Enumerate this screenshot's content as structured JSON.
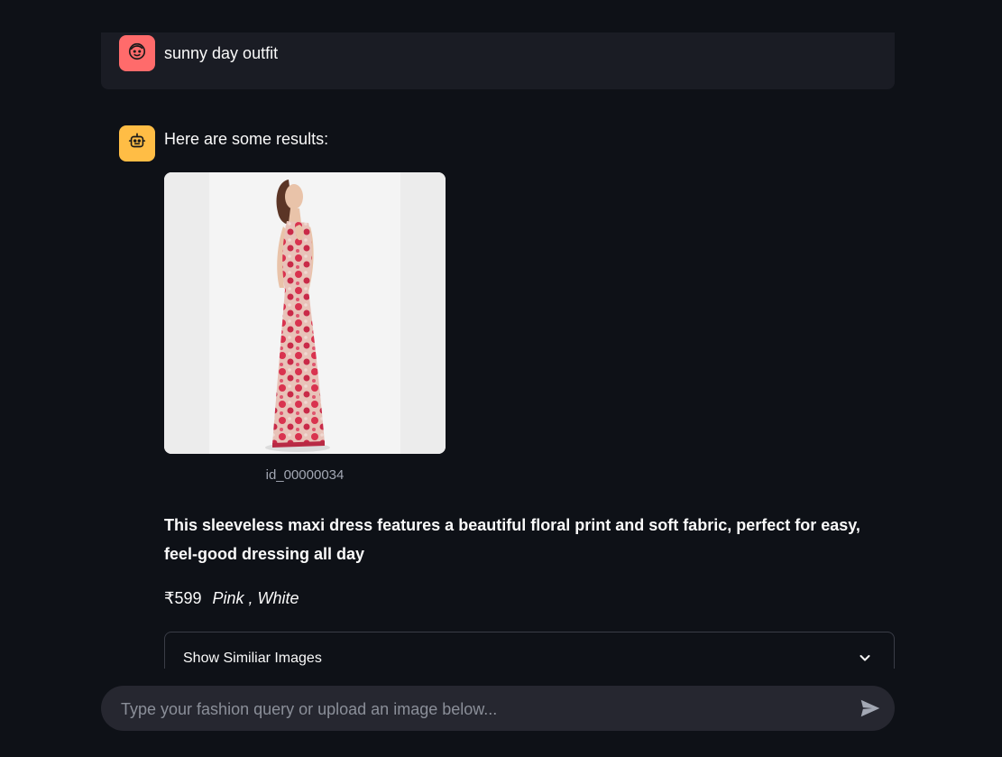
{
  "user_message": {
    "text": "sunny day outfit",
    "avatar_icon": "smiley-face-icon",
    "avatar_color": "#ff6b6b"
  },
  "bot_message": {
    "intro": "Here are some results:",
    "avatar_icon": "robot-icon",
    "avatar_color": "#ffbd45"
  },
  "product": {
    "image_caption": "id_00000034",
    "description": "This sleeveless maxi dress features a beautiful floral print and soft fabric, perfect for easy, feel-good dressing all day",
    "price": "₹599",
    "colors": "Pink , White"
  },
  "similar_expander": {
    "label": "Show Similiar Images",
    "icon": "chevron-down-icon"
  },
  "chat_input": {
    "placeholder": "Type your fashion query or upload an image below...",
    "send_icon": "send-icon"
  },
  "colors": {
    "background": "#0e1117",
    "user_bubble": "#1a1c24",
    "input_background": "#262730"
  }
}
